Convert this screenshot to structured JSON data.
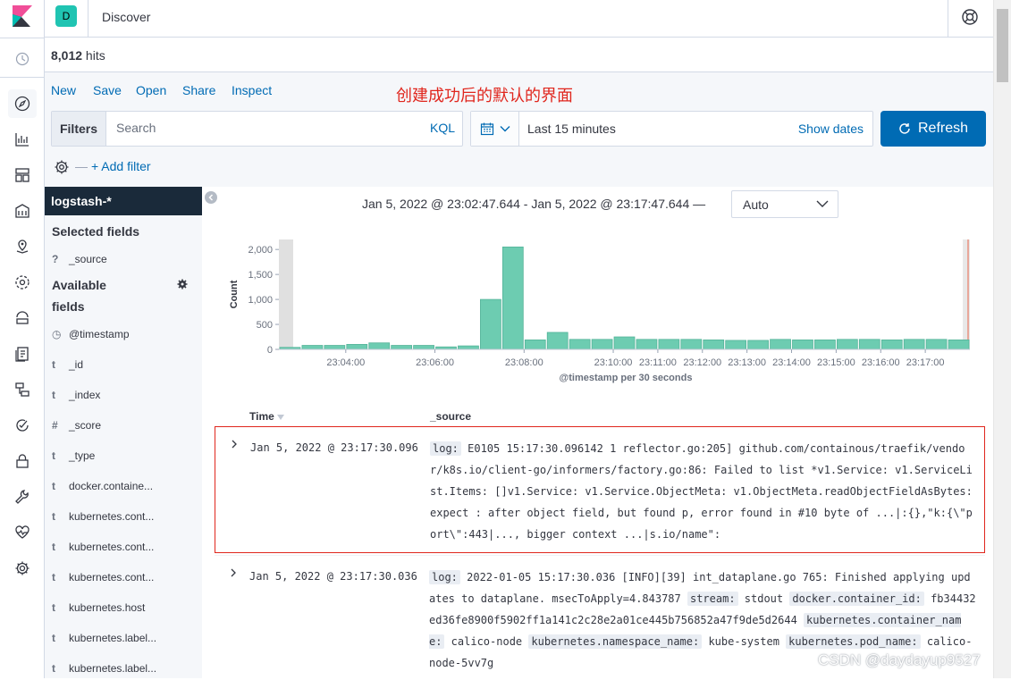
{
  "header": {
    "space_initial": "D",
    "title": "Discover"
  },
  "hits": {
    "count": "8,012",
    "suffix": " hits"
  },
  "top_nav": {
    "new": "New",
    "save": "Save",
    "open": "Open",
    "share": "Share",
    "inspect": "Inspect"
  },
  "annotation": "创建成功后的默认的界面",
  "query": {
    "filters_label": "Filters",
    "search_placeholder": "Search",
    "language": "KQL"
  },
  "time": {
    "range": "Last 15 minutes",
    "show_dates": "Show dates",
    "refresh": "Refresh"
  },
  "filter_bar": {
    "dash": "—",
    "add_filter": "+ Add filter"
  },
  "sidebar": {
    "index_pattern": "logstash-*",
    "selected_title": "Selected fields",
    "selected_fields": [
      {
        "type": "?",
        "name": "_source"
      }
    ],
    "available_title_1": "Available",
    "available_title_2": "fields",
    "available_fields": [
      {
        "type": "◷",
        "name": "@timestamp"
      },
      {
        "type": "t",
        "name": "_id"
      },
      {
        "type": "t",
        "name": "_index"
      },
      {
        "type": "#",
        "name": "_score"
      },
      {
        "type": "t",
        "name": "_type"
      },
      {
        "type": "t",
        "name": "docker.containe..."
      },
      {
        "type": "t",
        "name": "kubernetes.cont..."
      },
      {
        "type": "t",
        "name": "kubernetes.cont..."
      },
      {
        "type": "t",
        "name": "kubernetes.cont..."
      },
      {
        "type": "t",
        "name": "kubernetes.host"
      },
      {
        "type": "t",
        "name": "kubernetes.label..."
      },
      {
        "type": "t",
        "name": "kubernetes.label..."
      }
    ]
  },
  "chart_header": {
    "range_label": "Jan 5, 2022 @ 23:02:47.644 - Jan 5, 2022 @ 23:17:47.644 —",
    "interval": "Auto"
  },
  "chart_data": {
    "type": "bar",
    "ylabel": "Count",
    "xlabel": "@timestamp per 30 seconds",
    "ylim": [
      0,
      2200
    ],
    "yticks": [
      0,
      500,
      1000,
      1500,
      2000
    ],
    "ytick_labels": [
      "0",
      "500",
      "1,000",
      "1,500",
      "2,000"
    ],
    "xtick_labels": [
      "23:04:00",
      "23:06:00",
      "23:08:00",
      "23:10:00",
      "23:11:00",
      "23:12:00",
      "23:13:00",
      "23:14:00",
      "23:15:00",
      "23:16:00",
      "23:17:00"
    ],
    "bar_color": "#54b399",
    "values": [
      40,
      80,
      80,
      100,
      130,
      80,
      80,
      50,
      70,
      1000,
      2050,
      190,
      340,
      200,
      200,
      250,
      200,
      200,
      200,
      190,
      180,
      180,
      200,
      190,
      190,
      200,
      200,
      190,
      200,
      200,
      190
    ]
  },
  "table": {
    "time_header": "Time",
    "source_header": "_source",
    "rows": [
      {
        "time": "Jan 5, 2022 @ 23:17:30.096",
        "k1": "log:",
        "v1": " E0105 15:17:30.096142 1 reflector.go:205] github.com/containous/traefik/vendor/k8s.io/client-go/informers/factory.go:86: Failed to list *v1.Service: v1.ServiceList.Items: []v1.Service: v1.Service.ObjectMeta: v1.ObjectMeta.readObjectFieldAsBytes: expect : after object field, but found p, error found in #10 byte of ...|:{},\"k:{\\\"port\\\":443|..., bigger context ...|s.io/name\":"
      },
      {
        "time": "Jan 5, 2022 @ 23:17:30.036",
        "k1": "log:",
        "v1": " 2022-01-05 15:17:30.036 [INFO][39] int_dataplane.go 765: Finished applying updates to dataplane. msecToApply=4.843787 ",
        "k2": "stream:",
        "v2": " stdout ",
        "k3": "docker.container_id:",
        "v3": " fb34432ed36fe8900f5902ff1a141c2c28e2a01ce445b756852a47f9de5d2644 ",
        "k4": "kubernetes.container_name:",
        "v4": " calico-node ",
        "k5": "kubernetes.namespace_name:",
        "v5": " kube-system ",
        "k6": "kubernetes.pod_name:",
        "v6": " calico-node-5vv7g"
      }
    ]
  },
  "watermark": "CSDN @daydayup9527"
}
